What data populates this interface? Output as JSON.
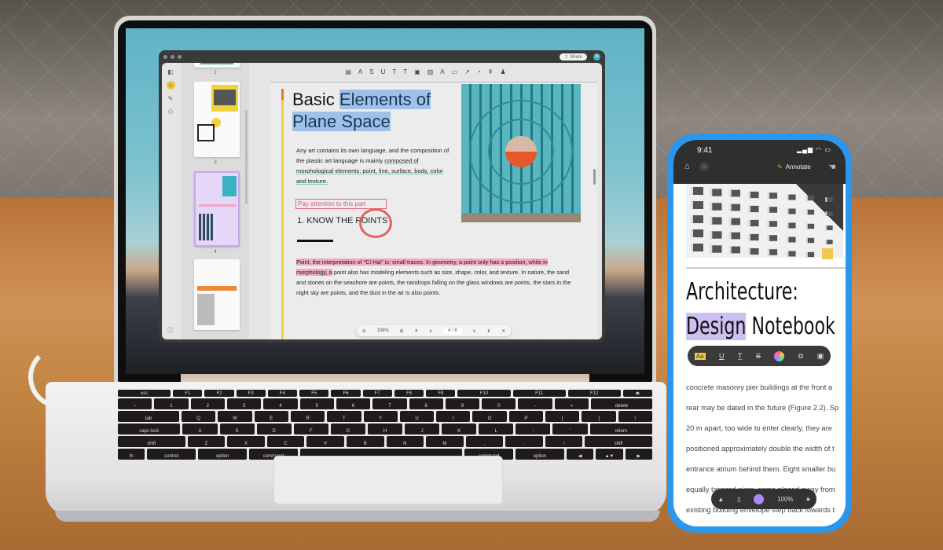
{
  "laptop_app": {
    "window_controls": [
      "close",
      "minimize",
      "maximize"
    ],
    "share_label": "Share",
    "avatar_initial": "A",
    "toolbar_icons": [
      "note-icon",
      "highlight-icon",
      "strikethrough-icon",
      "underline-icon",
      "squiggly-icon",
      "text-icon",
      "textbox-icon",
      "callout-icon",
      "pencil-icon",
      "eraser-icon",
      "shape-icon",
      "sticker-icon",
      "stamp-icon",
      "signature-icon"
    ],
    "toolbar_glyphs": [
      "▤",
      "A",
      "S",
      "U",
      "T",
      "T",
      "▣",
      "▥",
      "A",
      "▭",
      "↗",
      "◔",
      "⚱",
      "♟"
    ],
    "thumbnails": [
      {
        "page": "2"
      },
      {
        "page": "3"
      },
      {
        "page": "4"
      }
    ],
    "document": {
      "title_plain": "Basic ",
      "title_highlight_1": "Elements of",
      "title_highlight_2": "Plane Space",
      "para1_plain": "Any art contains its own language, and the composition of the plastic art language is mainly ",
      "para1_underlined": "composed of morphological elements: point, line, surface, body, color and texture.",
      "note": "Pay attention to this part",
      "heading": "1. KNOW THE POINTS",
      "para2_highlight": "Point, the interpretation of \"Ci Hai\" is: small traces. In geometry, a point only has a position, while in morphology, a",
      "para2_plain": " point also has modeling elements such as size, shape, color, and texture. In nature, the sand and stones on the seashore are points, the raindrops falling on the glass windows are points, the stars in the night sky are points, and the dust in the air is also points."
    },
    "zoom_bar": {
      "zoom": "158%",
      "current_page": "4",
      "separator": "/",
      "total_pages": "8"
    }
  },
  "phone_app": {
    "time": "9:41",
    "status": "▂▄▆ ◠ ▭",
    "annotate_label": "Annotate",
    "title_line1": "Architecture:",
    "title_highlight": "Design",
    "title_rest": " Notebook",
    "text_tools": [
      "Aa",
      "U",
      "T",
      "S"
    ],
    "body_lines": [
      "concrete masonry pier buildings at the front a",
      "rear may be dated in the future (Figure 2.2). Sp",
      "20 m apart, too wide to enter clearly, they are",
      "positioned approximately double the width of t",
      "entrance atrium behind them. Eight smaller bu",
      "equally tapered piers, some placed away from",
      "existing building envelope step back towards t"
    ],
    "bottom_bar": {
      "zoom": "100%"
    }
  },
  "keyboard": {
    "row1": [
      "esc",
      "F1",
      "F2",
      "F3",
      "F4",
      "F5",
      "F6",
      "F7",
      "F8",
      "F9",
      "F10",
      "F11",
      "F12",
      "⏏"
    ],
    "row2": [
      "~",
      "1",
      "2",
      "3",
      "4",
      "5",
      "6",
      "7",
      "8",
      "9",
      "0",
      "-",
      "=",
      "delete"
    ],
    "row3": [
      "tab",
      "Q",
      "W",
      "E",
      "R",
      "T",
      "Y",
      "U",
      "I",
      "O",
      "P",
      "[",
      "]",
      "\\"
    ],
    "row4": [
      "caps lock",
      "A",
      "S",
      "D",
      "F",
      "G",
      "H",
      "J",
      "K",
      "L",
      ";",
      "'",
      "return"
    ],
    "row5": [
      "shift",
      "Z",
      "X",
      "C",
      "V",
      "B",
      "N",
      "M",
      ",",
      ".",
      "/",
      "shift"
    ],
    "row6": [
      "fn",
      "control",
      "option",
      "command",
      "",
      "command",
      "option",
      "◀",
      "▲▼",
      "▶"
    ]
  }
}
